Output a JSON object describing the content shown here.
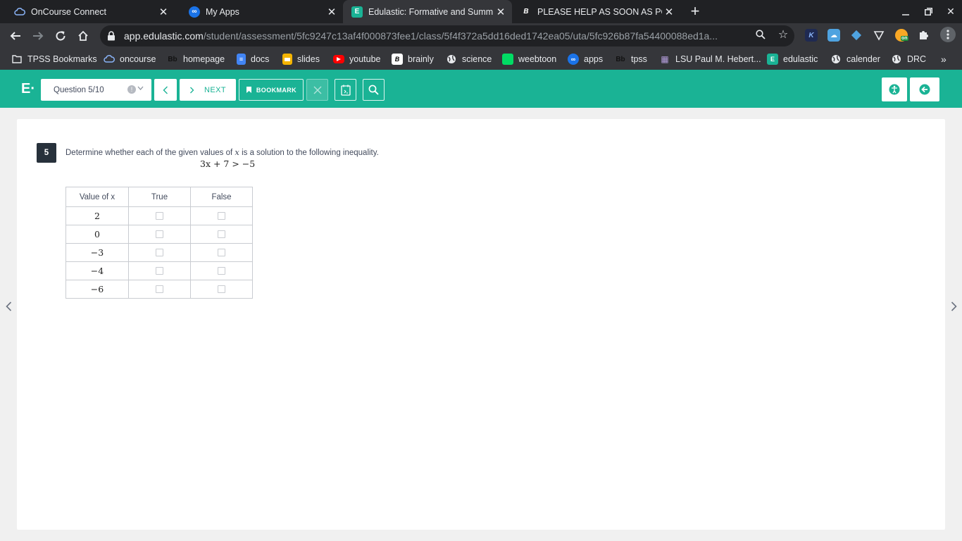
{
  "tabs": [
    {
      "title": "OnCourse Connect",
      "icon": "oncourse-cloud-icon"
    },
    {
      "title": "My Apps",
      "icon": "classlink-icon"
    },
    {
      "title": "Edulastic: Formative and Summ",
      "icon": "edulastic-icon",
      "active": true
    },
    {
      "title": "PLEASE HELP AS SOON AS POS",
      "icon": "brainly-icon"
    }
  ],
  "address_bar": {
    "host": "app.edulastic.com",
    "path": "/student/assessment/5fc9247c13af4f000873fee1/class/5f4f372a5dd16ded1742ea05/uta/5fc926b87fa54400088ed1a..."
  },
  "bookmarks": [
    {
      "label": "TPSS Bookmarks",
      "icon": "folder-icon"
    },
    {
      "label": "oncourse",
      "icon": "oncourse-cloud-icon"
    },
    {
      "label": "homepage",
      "icon": "blackboard-icon"
    },
    {
      "label": "docs",
      "icon": "google-docs-icon"
    },
    {
      "label": "slides",
      "icon": "google-slides-icon"
    },
    {
      "label": "youtube",
      "icon": "youtube-icon"
    },
    {
      "label": "brainly",
      "icon": "brainly-icon"
    },
    {
      "label": "science",
      "icon": "globe-icon"
    },
    {
      "label": "weebtoon",
      "icon": "webtoon-icon"
    },
    {
      "label": "apps",
      "icon": "classlink-icon"
    },
    {
      "label": "tpss",
      "icon": "blackboard-icon"
    },
    {
      "label": "LSU Paul M. Hebert...",
      "icon": "lsu-icon"
    },
    {
      "label": "edulastic",
      "icon": "edulastic-icon"
    },
    {
      "label": "calender",
      "icon": "globe-icon"
    },
    {
      "label": "DRC",
      "icon": "globe-icon"
    }
  ],
  "bookmark_glyphs": {
    "blackboard": "Bb",
    "brainly": "B",
    "edulastic": "E",
    "classlink": "∞",
    "lsu": "▦",
    "docs": "≡",
    "kami": "K",
    "extension_badge": "on"
  },
  "header": {
    "logo": "E·",
    "question_selector": "Question 5/10",
    "next_label": "NEXT",
    "bookmark_label": "BOOKMARK"
  },
  "question": {
    "number": "5",
    "stem_before": "Determine whether each of the given values of ",
    "stem_var": "x",
    "stem_after": " is a solution to the following inequality.",
    "equation": "3x + 7 > −5",
    "table": {
      "headers": [
        "Value of x",
        "True",
        "False"
      ],
      "rows": [
        "2",
        "0",
        "−3",
        "−4",
        "−6"
      ]
    }
  },
  "colors": {
    "brand": "#1ab395",
    "chrome_dark": "#202124",
    "chrome_toolbar": "#35363a",
    "qnum_bg": "#27313b"
  }
}
